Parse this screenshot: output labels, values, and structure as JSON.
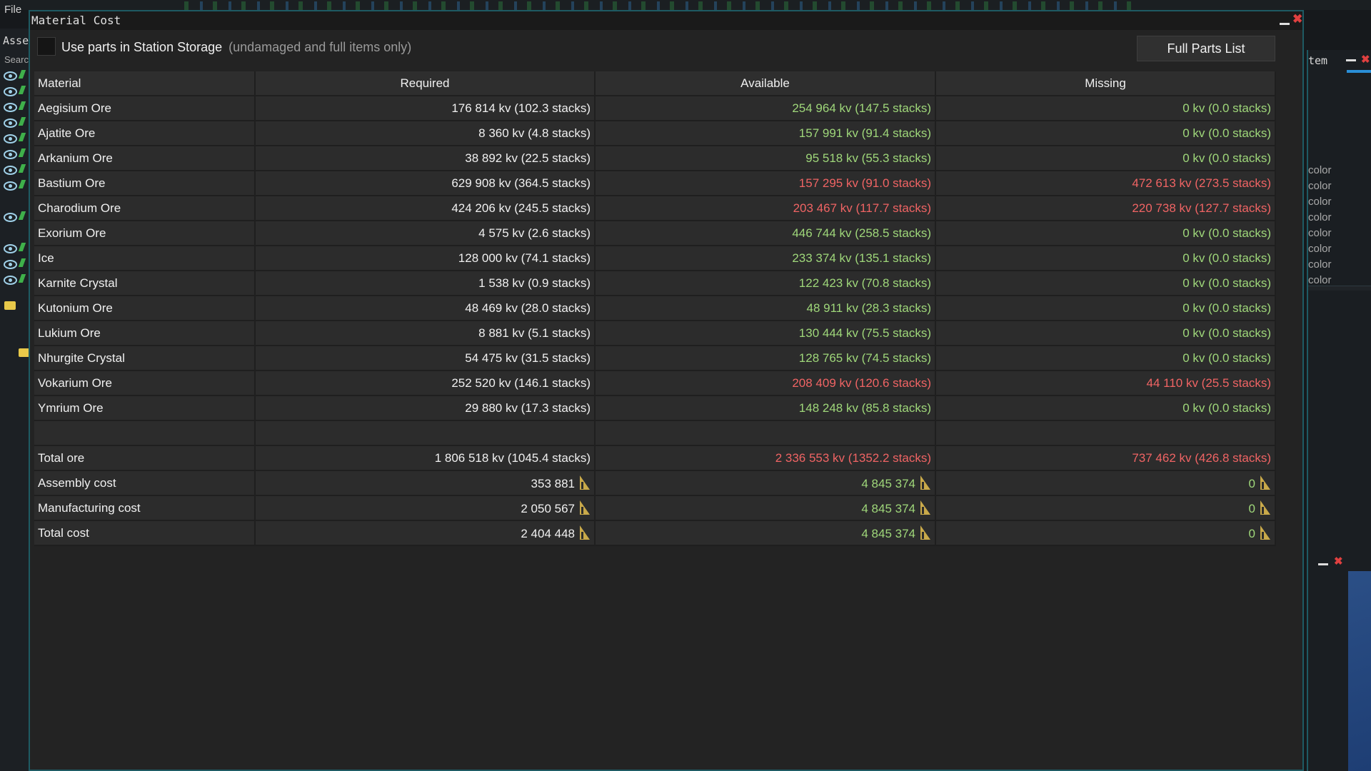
{
  "app": {
    "menu_file": "File",
    "left_panel_title": "Asse",
    "left_panel_search": "Searc",
    "right_panel_title": "tem",
    "right_panel_color_label": "color",
    "right_panel_color_count": 8
  },
  "dialog": {
    "title": "Material Cost",
    "storage_option": {
      "label": "Use parts in Station Storage",
      "note": "(undamaged and full items only)",
      "checked": false
    },
    "full_parts_button": "Full Parts List"
  },
  "table": {
    "headers": [
      "Material",
      "Required",
      "Available",
      "Missing"
    ],
    "rows": [
      {
        "material": "Aegisium Ore",
        "required": "176 814 kv (102.3 stacks)",
        "available": "254 964 kv (147.5 stacks)",
        "missing": "0 kv (0.0 stacks)",
        "status": "ok"
      },
      {
        "material": "Ajatite Ore",
        "required": "8 360 kv (4.8 stacks)",
        "available": "157 991 kv (91.4 stacks)",
        "missing": "0 kv (0.0 stacks)",
        "status": "ok"
      },
      {
        "material": "Arkanium Ore",
        "required": "38 892 kv (22.5 stacks)",
        "available": "95 518 kv (55.3 stacks)",
        "missing": "0 kv (0.0 stacks)",
        "status": "ok"
      },
      {
        "material": "Bastium Ore",
        "required": "629 908 kv (364.5 stacks)",
        "available": "157 295 kv (91.0 stacks)",
        "missing": "472 613 kv (273.5 stacks)",
        "status": "bad"
      },
      {
        "material": "Charodium Ore",
        "required": "424 206 kv (245.5 stacks)",
        "available": "203 467 kv (117.7 stacks)",
        "missing": "220 738 kv (127.7 stacks)",
        "status": "bad"
      },
      {
        "material": "Exorium Ore",
        "required": "4 575 kv (2.6 stacks)",
        "available": "446 744 kv (258.5 stacks)",
        "missing": "0 kv (0.0 stacks)",
        "status": "ok"
      },
      {
        "material": "Ice",
        "required": "128 000 kv (74.1 stacks)",
        "available": "233 374 kv (135.1 stacks)",
        "missing": "0 kv (0.0 stacks)",
        "status": "ok"
      },
      {
        "material": "Karnite Crystal",
        "required": "1 538 kv (0.9 stacks)",
        "available": "122 423 kv (70.8 stacks)",
        "missing": "0 kv (0.0 stacks)",
        "status": "ok"
      },
      {
        "material": "Kutonium Ore",
        "required": "48 469 kv (28.0 stacks)",
        "available": "48 911 kv (28.3 stacks)",
        "missing": "0 kv (0.0 stacks)",
        "status": "ok"
      },
      {
        "material": "Lukium Ore",
        "required": "8 881 kv (5.1 stacks)",
        "available": "130 444 kv (75.5 stacks)",
        "missing": "0 kv (0.0 stacks)",
        "status": "ok"
      },
      {
        "material": "Nhurgite Crystal",
        "required": "54 475 kv (31.5 stacks)",
        "available": "128 765 kv (74.5 stacks)",
        "missing": "0 kv (0.0 stacks)",
        "status": "ok"
      },
      {
        "material": "Vokarium Ore",
        "required": "252 520 kv (146.1 stacks)",
        "available": "208 409 kv (120.6 stacks)",
        "missing": "44 110 kv (25.5 stacks)",
        "status": "bad"
      },
      {
        "material": "Ymrium Ore",
        "required": "29 880 kv (17.3 stacks)",
        "available": "148 248 kv (85.8 stacks)",
        "missing": "0 kv (0.0 stacks)",
        "status": "ok"
      }
    ],
    "total_ore": {
      "label": "Total ore",
      "required": "1 806 518 kv (1045.4 stacks)",
      "available": "2 336 553 kv (1352.2 stacks)",
      "missing": "737 462 kv (426.8 stacks)",
      "status": "bad"
    },
    "costs": [
      {
        "label": "Assembly cost",
        "required": "353 881",
        "available": "4 845 374",
        "missing": "0",
        "status": "ok"
      },
      {
        "label": "Manufacturing cost",
        "required": "2 050 567",
        "available": "4 845 374",
        "missing": "0",
        "status": "ok"
      },
      {
        "label": "Total cost",
        "required": "2 404 448",
        "available": "4 845 374",
        "missing": "0",
        "status": "ok"
      }
    ],
    "currency_icon": "credits-icon"
  },
  "colors": {
    "ok": "#9fd77a",
    "bad": "#f06464",
    "accent_border": "#1e5a63",
    "close": "#e04040"
  }
}
